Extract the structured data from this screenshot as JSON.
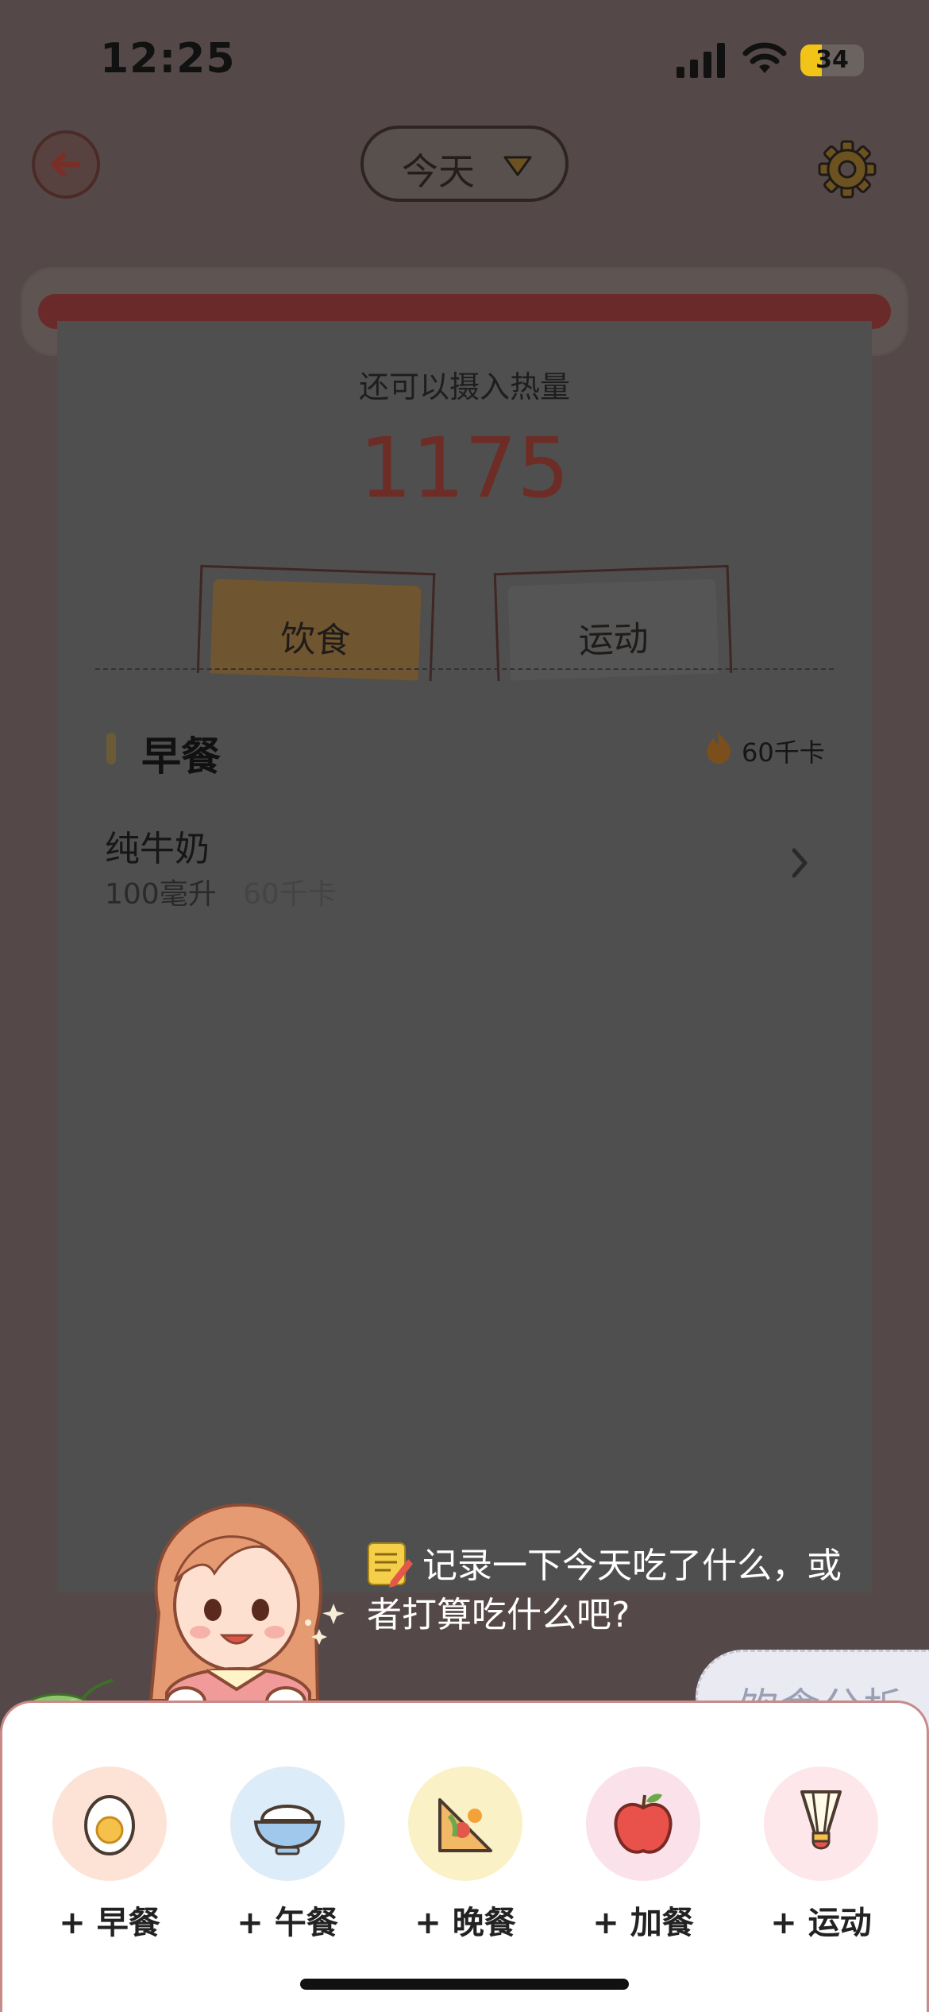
{
  "status_bar": {
    "time": "12:25",
    "battery": "34",
    "battery_level": 0.34
  },
  "nav": {
    "date_selector": "今天"
  },
  "calories": {
    "title": "还可以摄入热量",
    "value": "1175"
  },
  "tabs": [
    {
      "label": "饮食",
      "selected": true
    },
    {
      "label": "运动",
      "selected": false
    }
  ],
  "meal": {
    "title": "早餐",
    "calories": "60千卡",
    "item": {
      "name": "纯牛奶",
      "amount": "100毫升",
      "calories": "60千卡"
    }
  },
  "tip": {
    "text": "记录一下今天吃了什么，或者打算吃什么吧?"
  },
  "analysis_button": {
    "label": "饮食分析"
  },
  "actions": [
    {
      "label": "+ 早餐",
      "icon": "egg-icon",
      "bg": "#fde3d6"
    },
    {
      "label": "+ 午餐",
      "icon": "rice-bowl-icon",
      "bg": "#dcecf8"
    },
    {
      "label": "+ 晚餐",
      "icon": "sandwich-icon",
      "bg": "#fbf1c6"
    },
    {
      "label": "+ 加餐",
      "icon": "apple-icon",
      "bg": "#fbe1ea"
    },
    {
      "label": "+ 运动",
      "icon": "shuttlecock-icon",
      "bg": "#fde7ea"
    }
  ]
}
